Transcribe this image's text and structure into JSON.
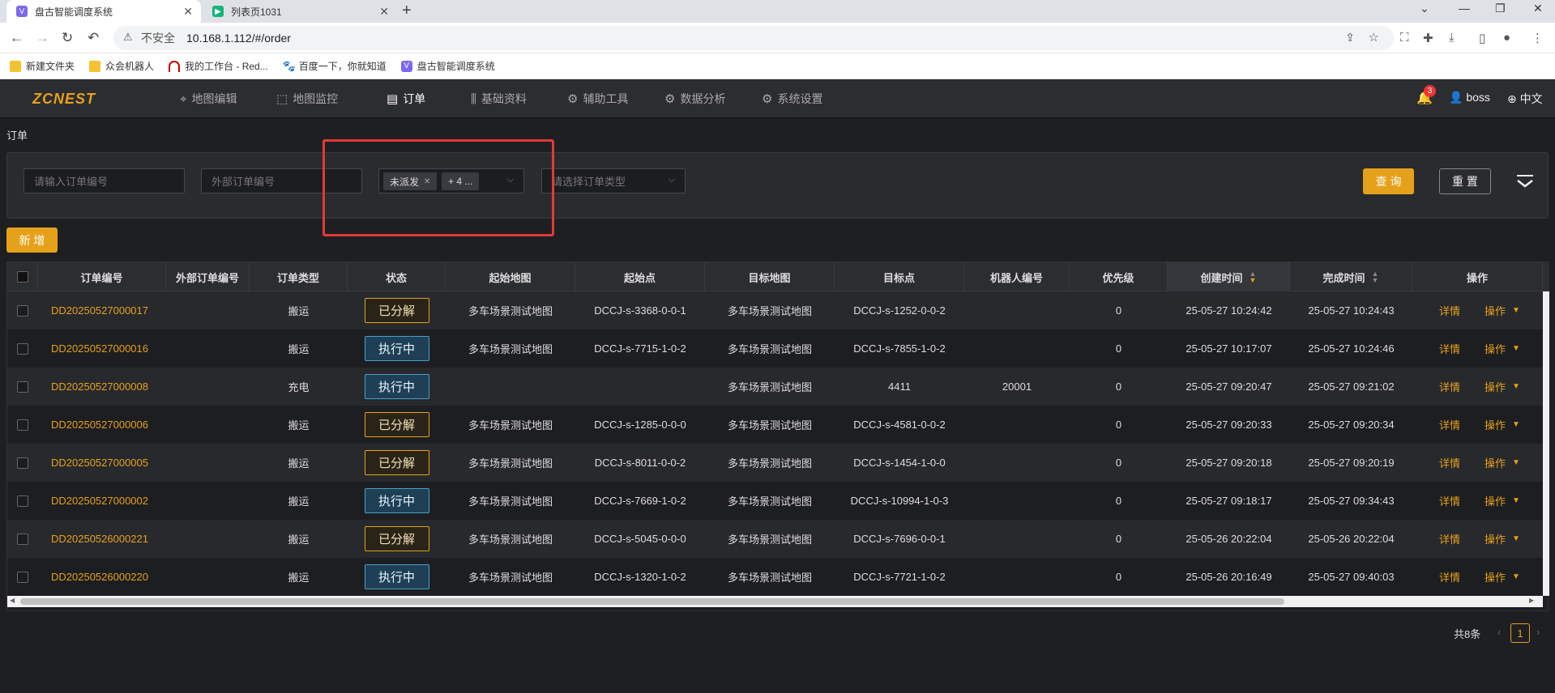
{
  "browser": {
    "tabs": [
      {
        "title": "盘古智能调度系统",
        "active": true
      },
      {
        "title": "列表页1031",
        "active": false
      }
    ],
    "insecure_label": "不安全",
    "url": "10.168.1.112/#/order",
    "bookmarks": [
      "新建文件夹",
      "众会机器人",
      "我的工作台 - Red...",
      "百度一下，你就知道",
      "盘古智能调度系统"
    ]
  },
  "app": {
    "logo": "ZCNEST",
    "menu": [
      "地图编辑",
      "地图监控",
      "订单",
      "基础资料",
      "辅助工具",
      "数据分析",
      "系统设置"
    ],
    "active_menu": "订单",
    "notifications": "3",
    "user": "boss",
    "language": "中文"
  },
  "breadcrumb": "订单",
  "filters": {
    "order_no_placeholder": "请输入订单编号",
    "ext_order_placeholder": "外部订单编号",
    "status_tag": "未派发",
    "more_tag": "+ 4 ...",
    "type_placeholder": "请选择订单类型",
    "query_label": "查 询",
    "reset_label": "重 置"
  },
  "add_label": "新 增",
  "table": {
    "headers": [
      "订单编号",
      "外部订单编号",
      "订单类型",
      "状态",
      "起始地图",
      "起始点",
      "目标地图",
      "目标点",
      "机器人编号",
      "优先级",
      "创建时间",
      "完成时间",
      "操作"
    ],
    "rows": [
      {
        "id": "DD20250527000017",
        "ext": "",
        "type": "搬运",
        "status": "已分解",
        "start_map": "多车场景测试地图",
        "start_pt": "DCCJ-s-3368-0-0-1",
        "target_map": "多车场景测试地图",
        "target_pt": "DCCJ-s-1252-0-0-2",
        "robot": "",
        "priority": "0",
        "created": "25-05-27 10:24:42",
        "finished": "25-05-27 10:24:43"
      },
      {
        "id": "DD20250527000016",
        "ext": "",
        "type": "搬运",
        "status": "执行中",
        "start_map": "多车场景测试地图",
        "start_pt": "DCCJ-s-7715-1-0-2",
        "target_map": "多车场景测试地图",
        "target_pt": "DCCJ-s-7855-1-0-2",
        "robot": "",
        "priority": "0",
        "created": "25-05-27 10:17:07",
        "finished": "25-05-27 10:24:46"
      },
      {
        "id": "DD20250527000008",
        "ext": "",
        "type": "充电",
        "status": "执行中",
        "start_map": "",
        "start_pt": "",
        "target_map": "多车场景测试地图",
        "target_pt": "4411",
        "robot": "20001",
        "priority": "0",
        "created": "25-05-27 09:20:47",
        "finished": "25-05-27 09:21:02"
      },
      {
        "id": "DD20250527000006",
        "ext": "",
        "type": "搬运",
        "status": "已分解",
        "start_map": "多车场景测试地图",
        "start_pt": "DCCJ-s-1285-0-0-0",
        "target_map": "多车场景测试地图",
        "target_pt": "DCCJ-s-4581-0-0-2",
        "robot": "",
        "priority": "0",
        "created": "25-05-27 09:20:33",
        "finished": "25-05-27 09:20:34"
      },
      {
        "id": "DD20250527000005",
        "ext": "",
        "type": "搬运",
        "status": "已分解",
        "start_map": "多车场景测试地图",
        "start_pt": "DCCJ-s-8011-0-0-2",
        "target_map": "多车场景测试地图",
        "target_pt": "DCCJ-s-1454-1-0-0",
        "robot": "",
        "priority": "0",
        "created": "25-05-27 09:20:18",
        "finished": "25-05-27 09:20:19"
      },
      {
        "id": "DD20250527000002",
        "ext": "",
        "type": "搬运",
        "status": "执行中",
        "start_map": "多车场景测试地图",
        "start_pt": "DCCJ-s-7669-1-0-2",
        "target_map": "多车场景测试地图",
        "target_pt": "DCCJ-s-10994-1-0-3",
        "robot": "",
        "priority": "0",
        "created": "25-05-27 09:18:17",
        "finished": "25-05-27 09:34:43"
      },
      {
        "id": "DD20250526000221",
        "ext": "",
        "type": "搬运",
        "status": "已分解",
        "start_map": "多车场景测试地图",
        "start_pt": "DCCJ-s-5045-0-0-0",
        "target_map": "多车场景测试地图",
        "target_pt": "DCCJ-s-7696-0-0-1",
        "robot": "",
        "priority": "0",
        "created": "25-05-26 20:22:04",
        "finished": "25-05-26 20:22:04"
      },
      {
        "id": "DD20250526000220",
        "ext": "",
        "type": "搬运",
        "status": "执行中",
        "start_map": "多车场景测试地图",
        "start_pt": "DCCJ-s-1320-1-0-2",
        "target_map": "多车场景测试地图",
        "target_pt": "DCCJ-s-7721-1-0-2",
        "robot": "",
        "priority": "0",
        "created": "25-05-26 20:16:49",
        "finished": "25-05-27 09:40:03"
      }
    ],
    "detail_label": "详情",
    "op_label": "操作"
  },
  "pagination": {
    "total": "共8条",
    "current": "1"
  },
  "colors": {
    "accent": "#e6a11b",
    "running": "#4a9fcc",
    "highlight": "#e53838"
  }
}
